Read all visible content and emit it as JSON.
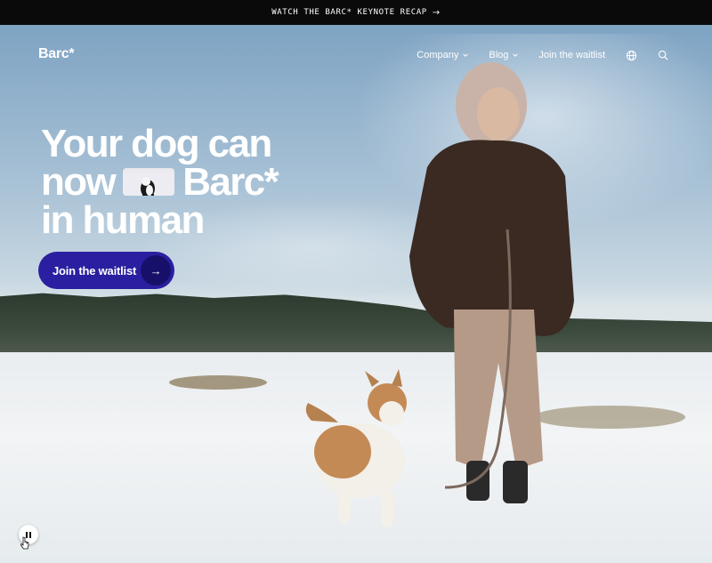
{
  "announcement": {
    "text": "WATCH THE BARC* KEYNOTE RECAP",
    "arrow": "→"
  },
  "brand": {
    "logo": "Barc*"
  },
  "nav": {
    "items": [
      {
        "label": "Company",
        "has_dropdown": true
      },
      {
        "label": "Blog",
        "has_dropdown": true
      },
      {
        "label": "Join the waitlist",
        "has_dropdown": false
      }
    ],
    "icons": [
      "globe-icon",
      "search-icon"
    ]
  },
  "hero": {
    "headline_line1": "Your dog can",
    "headline_line2_a": "now",
    "headline_line2_b": "Barc*",
    "headline_line3": "in human",
    "cta_label": "Join the waitlist",
    "cta_arrow": "→"
  },
  "media_controls": {
    "pause_icon": "pause-icon"
  },
  "colors": {
    "announcement_bg": "#0a0a0a",
    "cta_bg": "#2a1fa0",
    "cta_circle": "#17106a",
    "text": "#ffffff"
  }
}
